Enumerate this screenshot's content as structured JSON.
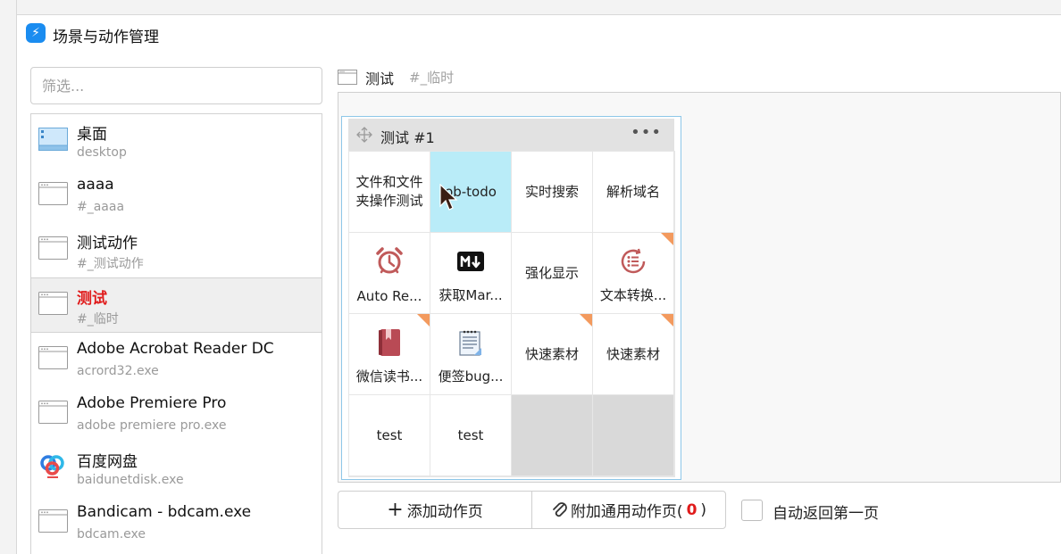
{
  "window": {
    "title": "场景与动作管理"
  },
  "filter": {
    "placeholder": "筛选..."
  },
  "scenes": [
    {
      "name": "桌面",
      "sub": "desktop",
      "icon": "desktop-icon"
    },
    {
      "name": "aaaa",
      "sub": "#_aaaa",
      "icon": "window-icon"
    },
    {
      "name": "测试动作",
      "sub": "#_测试动作",
      "icon": "window-icon"
    },
    {
      "name": "测试",
      "sub": "#_临时",
      "icon": "window-icon",
      "selected": true
    },
    {
      "name": "Adobe Acrobat Reader DC",
      "sub": "acrord32.exe",
      "icon": "window-icon"
    },
    {
      "name": "Adobe Premiere Pro",
      "sub": "adobe premiere pro.exe",
      "icon": "window-icon"
    },
    {
      "name": "百度网盘",
      "sub": "baidunetdisk.exe",
      "icon": "baidu-netdisk-icon"
    },
    {
      "name": "Bandicam - bdcam.exe",
      "sub": "bdcam.exe",
      "icon": "window-icon"
    }
  ],
  "breadcrumb": {
    "name": "测试",
    "tag": "#_临时"
  },
  "page": {
    "title": "测试 #1",
    "more": "•••",
    "cells": [
      {
        "text": "文件和文件夹操作测试"
      },
      {
        "text": "ob-todo",
        "highlighted": true
      },
      {
        "text": "实时搜索"
      },
      {
        "text": "解析域名"
      },
      {
        "label": "Auto Re...",
        "icon": "alarm-clock-icon"
      },
      {
        "label": "获取Mar...",
        "icon": "markdown-icon"
      },
      {
        "text": "强化显示"
      },
      {
        "label": "文本转换...",
        "icon": "list-circle-icon",
        "corner": true
      },
      {
        "label": "微信读书...",
        "icon": "bookmark-book-icon",
        "corner": true
      },
      {
        "label": "便签bug...",
        "icon": "notepad-icon"
      },
      {
        "text": "快速素材",
        "corner": true
      },
      {
        "text": "快速素材",
        "corner": true
      },
      {
        "text": "test"
      },
      {
        "text": "test"
      },
      {
        "empty": true
      },
      {
        "empty": true
      }
    ]
  },
  "actions": {
    "add_label": "添加动作页",
    "attach_label": "附加通用动作页(",
    "attach_count": "0",
    "attach_close": ")",
    "auto_return_label": "自动返回第一页",
    "auto_return_checked": false
  },
  "colors": {
    "accent_red": "#e01b1b",
    "highlight": "#b9ecf8",
    "corner": "#f39a5e",
    "app_blue": "#1a8cf0"
  }
}
